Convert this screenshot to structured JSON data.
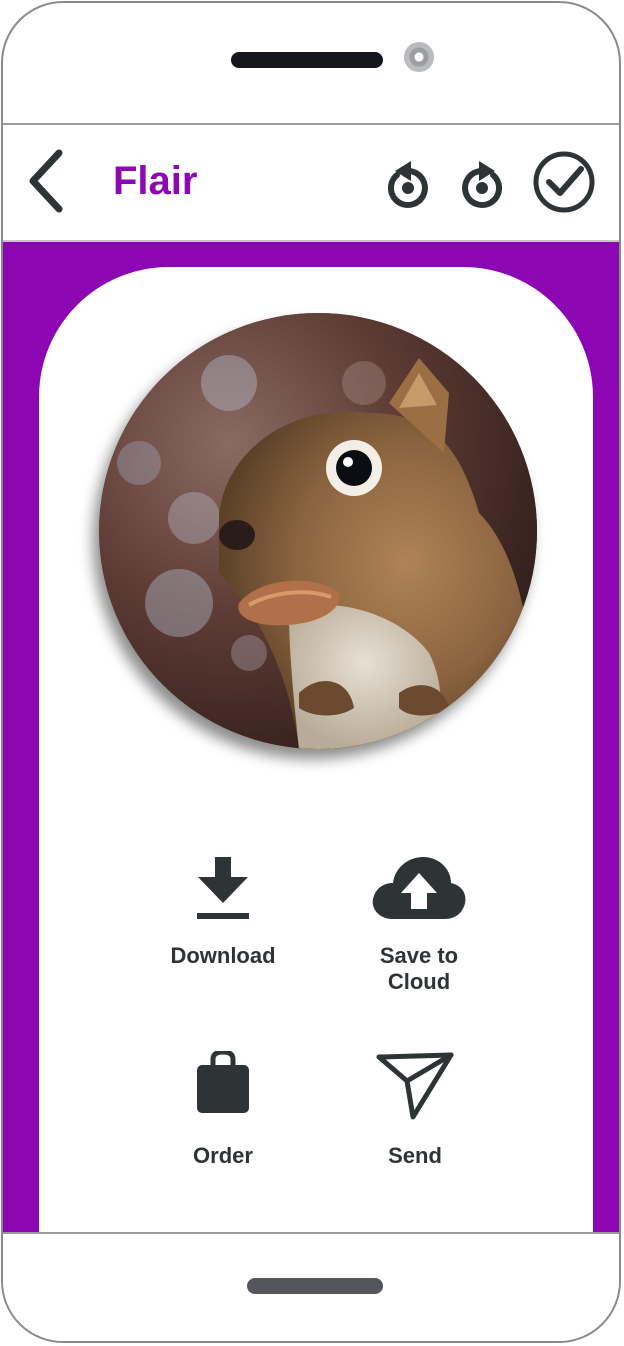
{
  "app_bar": {
    "title": "Flair",
    "back_icon": "chevron-left-icon",
    "undo_icon": "undo-icon",
    "redo_icon": "redo-icon",
    "done_icon": "check-circle-icon"
  },
  "colors": {
    "brand": "#8e07b4",
    "icon": "#2e3436"
  },
  "photo": {
    "subject_icon": "squirrel-photo"
  },
  "actions": [
    {
      "label": "Download",
      "icon": "download-icon"
    },
    {
      "label": "Save to\nCloud",
      "icon": "cloud-upload-icon"
    },
    {
      "label": "Order",
      "icon": "shopping-bag-icon"
    },
    {
      "label": "Send",
      "icon": "send-icon"
    }
  ]
}
